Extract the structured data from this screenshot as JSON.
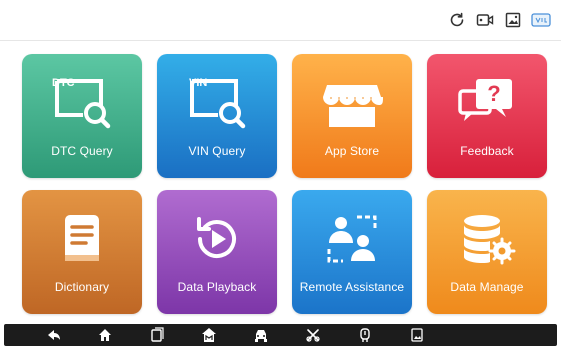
{
  "top_icons": [
    "refresh-icon",
    "screen-record-icon",
    "screenshot-icon",
    "vci-icon"
  ],
  "tiles": [
    {
      "label": "DTC Query",
      "badge": "DTC",
      "icon": "dtc-query-icon",
      "color_top": "#5cc7a3",
      "color_bottom": "#2e9a77"
    },
    {
      "label": "VIN Query",
      "badge": "VIN",
      "icon": "vin-query-icon",
      "color_top": "#33aee8",
      "color_bottom": "#1a6fc3"
    },
    {
      "label": "App Store",
      "icon": "store-icon",
      "color_top": "#ffb24a",
      "color_bottom": "#f07a1a"
    },
    {
      "label": "Feedback",
      "icon": "feedback-icon",
      "color_top": "#f2566d",
      "color_bottom": "#d8203b"
    },
    {
      "label": "Dictionary",
      "icon": "book-icon",
      "color_top": "#e39443",
      "color_bottom": "#bf6725"
    },
    {
      "label": "Data Playback",
      "icon": "playback-icon",
      "color_top": "#b06cd0",
      "color_bottom": "#7d36a8"
    },
    {
      "label": "Remote Assistance",
      "icon": "remote-assistance-icon",
      "color_top": "#3aa9ee",
      "color_bottom": "#1b74c9"
    },
    {
      "label": "Data Manage",
      "icon": "database-gear-icon",
      "color_top": "#f9b44c",
      "color_bottom": "#ef8a1c"
    }
  ],
  "bottom_icons": [
    "back-icon",
    "home-icon",
    "recent-apps-icon",
    "diagnosis-home-icon",
    "car-icon",
    "tools-icon",
    "vci-plug-icon",
    "screenshot-icon"
  ]
}
